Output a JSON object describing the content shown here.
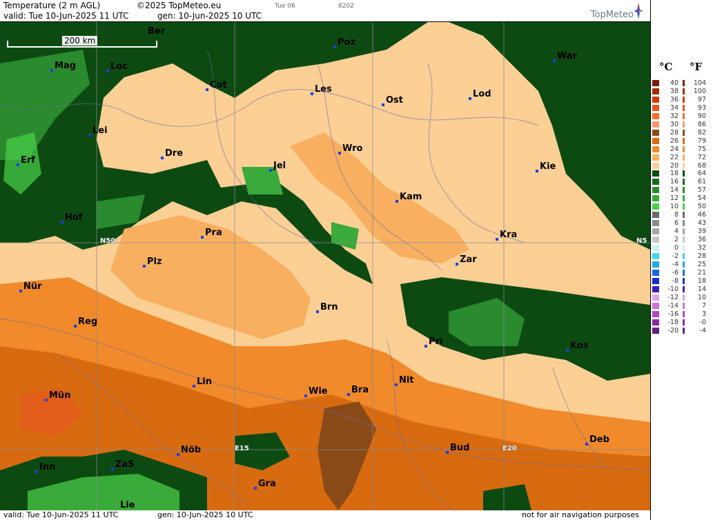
{
  "header": {
    "title": "Temperature (2 m AGL)",
    "copyright": "©2025 TopMeteo.eu",
    "forecast_day": "Tue 06",
    "code": "8202",
    "valid": "valid:  Tue  10-Jun-2025  11 UTC",
    "generated": "gen:  10-Jun-2025 10 UTC",
    "brand": "TopMeteo"
  },
  "footer": {
    "valid": "valid:  Tue  10-Jun-2025  11 UTC",
    "generated": "gen:  10-Jun-2025 10 UTC",
    "disclaimer": "not for air navigation purposes"
  },
  "map": {
    "scale_label": "200 km",
    "coords": [
      {
        "label": "N50",
        "name": "lat-n50-west"
      },
      {
        "label": "N5",
        "name": "lat-n50-east"
      },
      {
        "label": "E15",
        "name": "lon-e15"
      },
      {
        "label": "E20",
        "name": "lon-e20"
      }
    ],
    "cities": [
      "Ber",
      "Poz",
      "War",
      "Mag",
      "Loc",
      "Cot",
      "Les",
      "Ost",
      "Lod",
      "Lei",
      "Erf",
      "Dre",
      "Wro",
      "Jel",
      "Kie",
      "Kam",
      "Hof",
      "Pra",
      "Kra",
      "Zar",
      "Plz",
      "Nür",
      "Brn",
      "Reg",
      "Pri",
      "Kos",
      "Lin",
      "Nit",
      "Wie",
      "Bra",
      "Mün",
      "Bud",
      "Deb",
      "Nöb",
      "ZaS",
      "Inn",
      "Gra",
      "Lie"
    ]
  },
  "legend": {
    "celsius_unit": "°C",
    "fahrenheit_unit": "°F",
    "celsius": [
      "40",
      "38",
      "36",
      "34",
      "32",
      "30",
      "28",
      "26",
      "24",
      "22",
      "20",
      "18",
      "16",
      "14",
      "12",
      "10",
      "8",
      "6",
      "4",
      "2",
      "0",
      "-2",
      "-4",
      "-6",
      "-8",
      "-10",
      "-12",
      "-14",
      "-16",
      "-18",
      "-20"
    ],
    "fahrenheit": [
      "104",
      "100",
      "97",
      "93",
      "90",
      "86",
      "82",
      "79",
      "75",
      "72",
      "68",
      "64",
      "61",
      "57",
      "54",
      "50",
      "46",
      "43",
      "39",
      "36",
      "32",
      "28",
      "25",
      "21",
      "18",
      "14",
      "10",
      "7",
      "3",
      "-0",
      "-4"
    ],
    "colors": [
      "#7a1e08",
      "#a52a0a",
      "#cc3a10",
      "#e85520",
      "#f07030",
      "#f89a70",
      "#8a4a18",
      "#d86a10",
      "#f08a2a",
      "#f8b060",
      "#fcd09a",
      "#0c4a12",
      "#1a6a1e",
      "#2a8a2e",
      "#3aaa3a",
      "#48d048",
      "#6a6a6a",
      "#8a8a8a",
      "#a8a8a8",
      "#c8c8c8",
      "#c8f0f8",
      "#40d8e8",
      "#20a8e0",
      "#1868d8",
      "#1a30c8",
      "#3a20b8",
      "#e0a0e8",
      "#d070d8",
      "#b048c0",
      "#8a2aa0",
      "#602080"
    ]
  }
}
